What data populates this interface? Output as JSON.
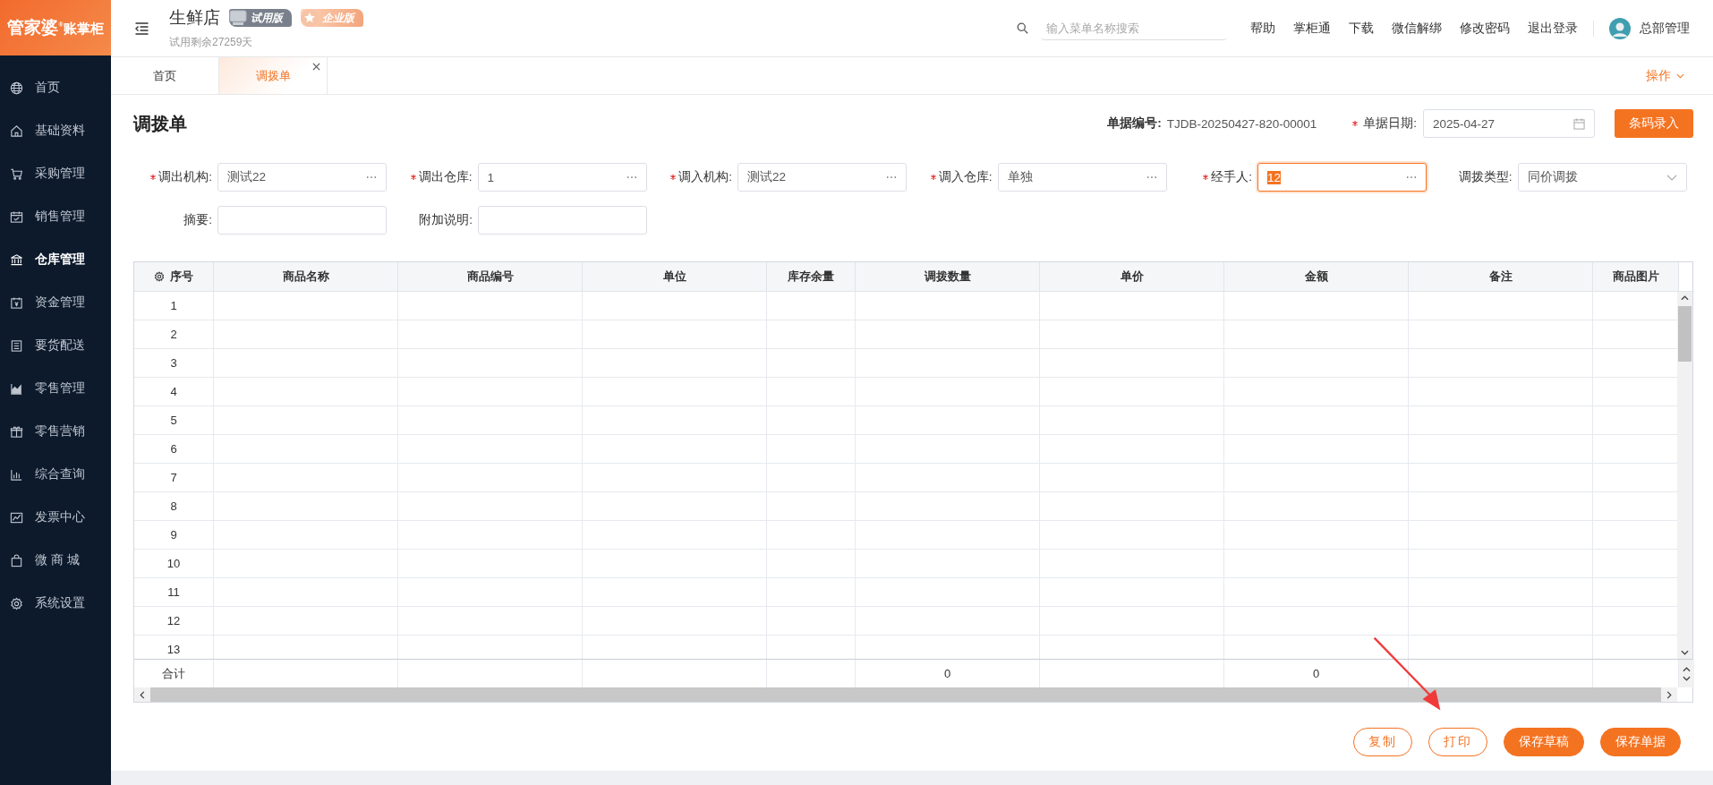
{
  "logo": {
    "name": "管家婆",
    "mark": "®",
    "product": "账掌柜"
  },
  "header": {
    "store": "生鲜店",
    "badges": [
      {
        "label": "试用版",
        "kind": "trial"
      },
      {
        "label": "企业版",
        "kind": "enterprise"
      }
    ],
    "trial_remaining": "试用剩余27259天",
    "search": {
      "placeholder": "输入菜单名称搜索"
    },
    "links": [
      "帮助",
      "掌柜通",
      "下载",
      "微信解绑",
      "修改密码",
      "退出登录"
    ],
    "user": "总部管理"
  },
  "sidebar": {
    "items": [
      {
        "label": "首页",
        "selected": false
      },
      {
        "label": "基础资料",
        "selected": false
      },
      {
        "label": "采购管理",
        "selected": false
      },
      {
        "label": "销售管理",
        "selected": false
      },
      {
        "label": "仓库管理",
        "selected": true
      },
      {
        "label": "资金管理",
        "selected": false
      },
      {
        "label": "要货配送",
        "selected": false
      },
      {
        "label": "零售管理",
        "selected": false
      },
      {
        "label": "零售营销",
        "selected": false
      },
      {
        "label": "综合查询",
        "selected": false
      },
      {
        "label": "发票中心",
        "selected": false
      },
      {
        "label": "微 商 城",
        "selected": false
      },
      {
        "label": "系统设置",
        "selected": false
      }
    ]
  },
  "tabs": [
    {
      "label": "首页",
      "selected": false,
      "closable": false
    },
    {
      "label": "调拨单",
      "selected": true,
      "closable": true
    }
  ],
  "tab_actions": "操作",
  "form": {
    "title": "调拨单",
    "doc_no_label": "单据编号:",
    "doc_no": "TJDB-20250427-820-00001",
    "date": {
      "label": "单据日期:",
      "required": true,
      "value": "2025-04-27"
    },
    "barcode_button": "条码录入",
    "field_rows": [
      [
        {
          "label": "调出机构:",
          "required": true,
          "kind": "picker",
          "value": "测试22",
          "focused": false
        },
        {
          "label": "调出仓库:",
          "required": true,
          "kind": "picker",
          "value": "1",
          "focused": false
        },
        {
          "label": "调入机构:",
          "required": true,
          "kind": "picker",
          "value": "测试22",
          "focused": false
        },
        {
          "label": "调入仓库:",
          "required": true,
          "kind": "picker",
          "value": "单独",
          "focused": false
        },
        {
          "label": "经手人:",
          "required": true,
          "kind": "picker",
          "value": "12",
          "focused": true
        },
        {
          "label": "调拨类型:",
          "required": false,
          "kind": "select",
          "value": "同价调拨",
          "focused": false
        }
      ],
      [
        {
          "label": "摘要:",
          "required": false,
          "kind": "text",
          "focused": false
        },
        {
          "label": "附加说明:",
          "required": false,
          "kind": "text",
          "focused": false
        }
      ]
    ]
  },
  "table": {
    "columns": [
      "序号",
      "商品名称",
      "商品编号",
      "单位",
      "库存余量",
      "调拨数量",
      "单价",
      "金额",
      "备注",
      "商品图片"
    ],
    "rows": [
      "1",
      "2",
      "3",
      "4",
      "5",
      "6",
      "7",
      "8",
      "9",
      "10",
      "11",
      "12",
      "13"
    ],
    "footer": {
      "label": "合计",
      "quantity_total": "0",
      "amount_total": "0"
    }
  },
  "buttons": [
    {
      "label": "复制",
      "kind": "outline"
    },
    {
      "label": "打印",
      "kind": "outline"
    },
    {
      "label": "保存草稿",
      "kind": "primary"
    },
    {
      "label": "保存单据",
      "kind": "primary"
    }
  ]
}
